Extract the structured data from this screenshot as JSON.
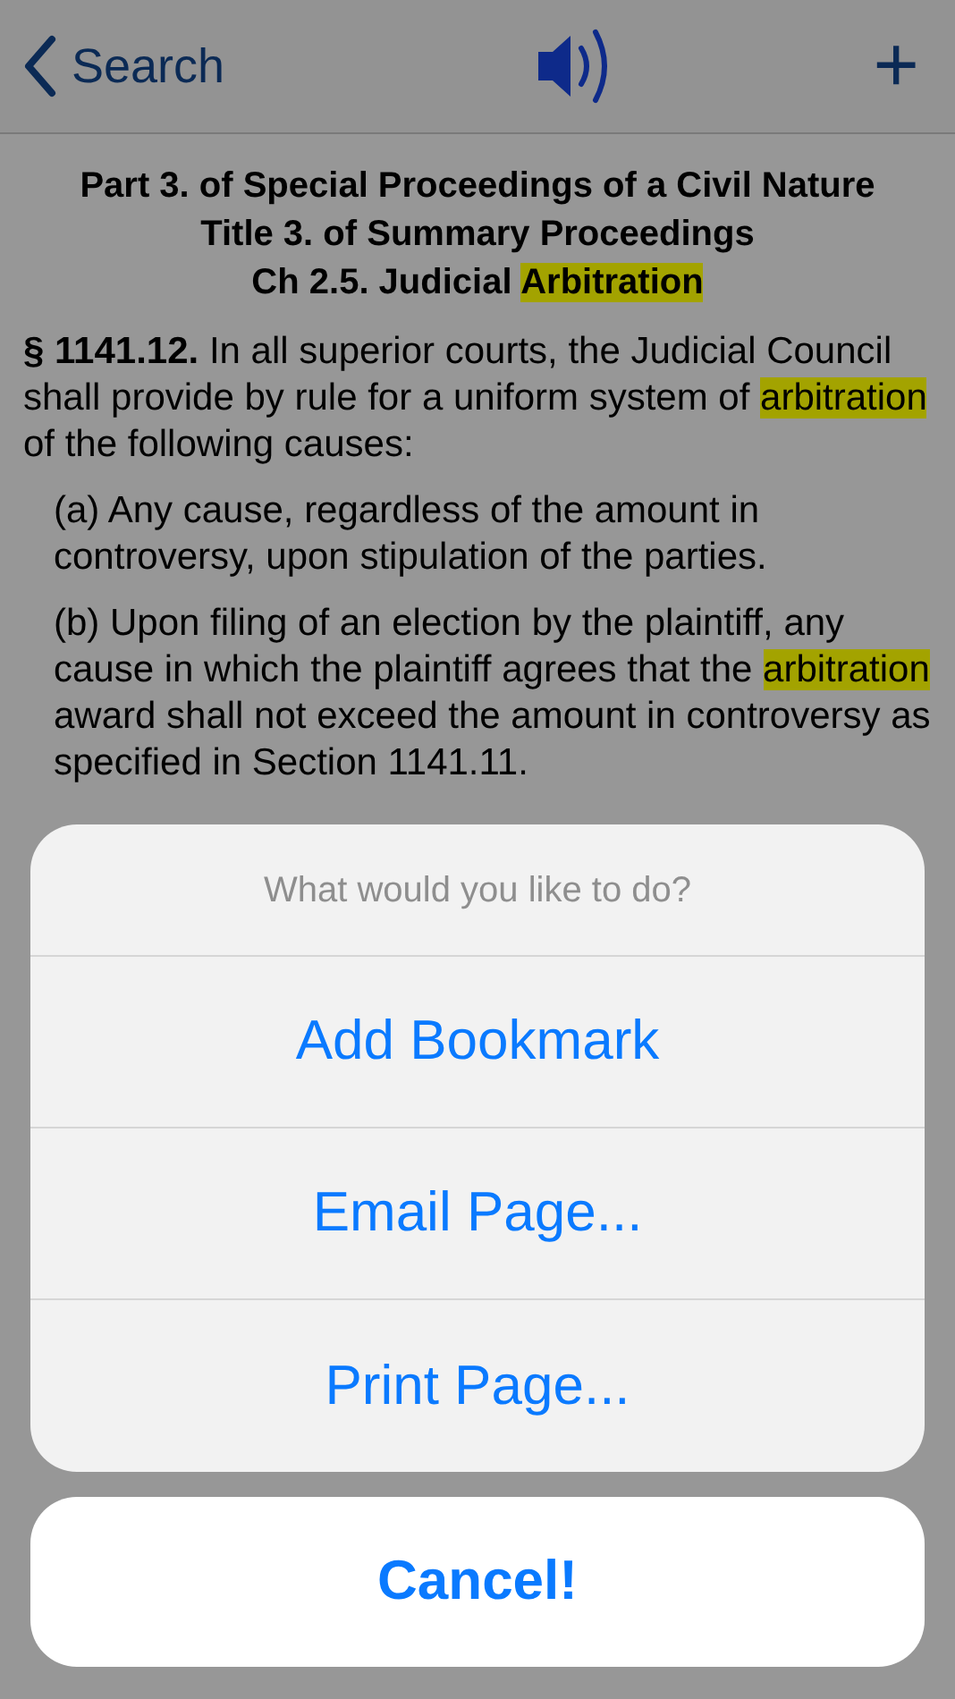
{
  "nav": {
    "back_label": "Search",
    "add_label": "+"
  },
  "headings": [
    "Part 3. of Special Proceedings of a Civil Nature",
    "Title 3. of Summary Proceedings"
  ],
  "chapter": [
    {
      "text": "Ch 2.5. Judicial ",
      "highlight": false
    },
    {
      "text": "Arbitration",
      "highlight": true
    }
  ],
  "paragraphs": [
    {
      "indent": false,
      "segments": [
        {
          "text": "**§ 1141.12.** In all superior courts, the Judicial Council shall provide by rule for a uniform system of ",
          "highlight": false
        },
        {
          "text": "arbitration",
          "highlight": true
        },
        {
          "text": " of the following causes:",
          "highlight": false
        }
      ]
    },
    {
      "indent": true,
      "segments": [
        {
          "text": "(a) Any cause, regardless of the amount in controversy, upon stipulation of the parties.",
          "highlight": false
        }
      ]
    },
    {
      "indent": true,
      "segments": [
        {
          "text": "(b) Upon filing of an election by the plaintiff, any cause in which the plaintiff agrees that the ",
          "highlight": false
        },
        {
          "text": "arbitration",
          "highlight": true
        },
        {
          "text": " award shall not exceed the amount in controversy as specified in Section 1141.11.",
          "highlight": false
        }
      ]
    }
  ],
  "action_sheet": {
    "title": "What would you like to do?",
    "actions": [
      "Add Bookmark",
      "Email Page...",
      "Print Page..."
    ],
    "cancel": "Cancel!"
  }
}
